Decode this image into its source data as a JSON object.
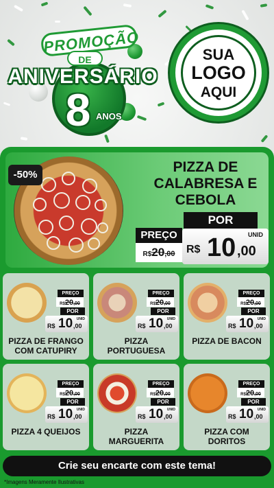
{
  "header": {
    "badge": {
      "promo": "PROMOÇÃO",
      "de": "DE",
      "title": "ANIVERSÁRIO",
      "number": "8",
      "years": "ANOS"
    },
    "logo": {
      "line1": "SUA",
      "line2": "LOGO",
      "line3": "AQUI"
    }
  },
  "featured": {
    "discount": "-50%",
    "title_line1": "PIZZA DE",
    "title_line2": "CALABRESA E",
    "title_line3": "CEBOLA",
    "preco_label": "PREÇO",
    "por_label": "POR",
    "old_currency": "R$",
    "old_price": "20",
    "old_cents": ",00",
    "unit": "UNID",
    "new_currency": "R$",
    "new_price": "10",
    "new_cents": ",00"
  },
  "items": [
    {
      "title_line1": "PIZZA DE FRANGO",
      "title_line2": "COM CATUPIRY",
      "preco_label": "PREÇO",
      "old_currency": "R$",
      "old_price": "20",
      "old_cents": ",00",
      "por_label": "POR",
      "unit": "UNID",
      "new_currency": "R$",
      "new_price": "10",
      "new_cents": ",00"
    },
    {
      "title_line1": "PIZZA",
      "title_line2": "PORTUGUESA",
      "preco_label": "PREÇO",
      "old_currency": "R$",
      "old_price": "20",
      "old_cents": ",00",
      "por_label": "POR",
      "unit": "UNID",
      "new_currency": "R$",
      "new_price": "10",
      "new_cents": ",00"
    },
    {
      "title_line1": "PIZZA DE BACON",
      "title_line2": "",
      "preco_label": "PREÇO",
      "old_currency": "R$",
      "old_price": "20",
      "old_cents": ",00",
      "por_label": "POR",
      "unit": "UNID",
      "new_currency": "R$",
      "new_price": "10",
      "new_cents": ",00"
    },
    {
      "title_line1": "PIZZA 4 QUEIJOS",
      "title_line2": "",
      "preco_label": "PREÇO",
      "old_currency": "R$",
      "old_price": "20",
      "old_cents": ",00",
      "por_label": "POR",
      "unit": "UNID",
      "new_currency": "R$",
      "new_price": "10",
      "new_cents": ",00"
    },
    {
      "title_line1": "PIZZA",
      "title_line2": "MARGUERITA",
      "preco_label": "PREÇO",
      "old_currency": "R$",
      "old_price": "20",
      "old_cents": ",00",
      "por_label": "POR",
      "unit": "UNID",
      "new_currency": "R$",
      "new_price": "10",
      "new_cents": ",00"
    },
    {
      "title_line1": "PIZZA COM",
      "title_line2": "DORITOS",
      "preco_label": "PREÇO",
      "old_currency": "R$",
      "old_price": "20",
      "old_cents": ",00",
      "por_label": "POR",
      "unit": "UNID",
      "new_currency": "R$",
      "new_price": "10",
      "new_cents": ",00"
    }
  ],
  "cta": "Crie seu encarte com este tema!",
  "disclaimer": "*Imagens Meramente Ilustrativas",
  "colors": {
    "brand_green": "#1a9a2e",
    "dark_green": "#0e5e1f",
    "label_black": "#111111"
  }
}
